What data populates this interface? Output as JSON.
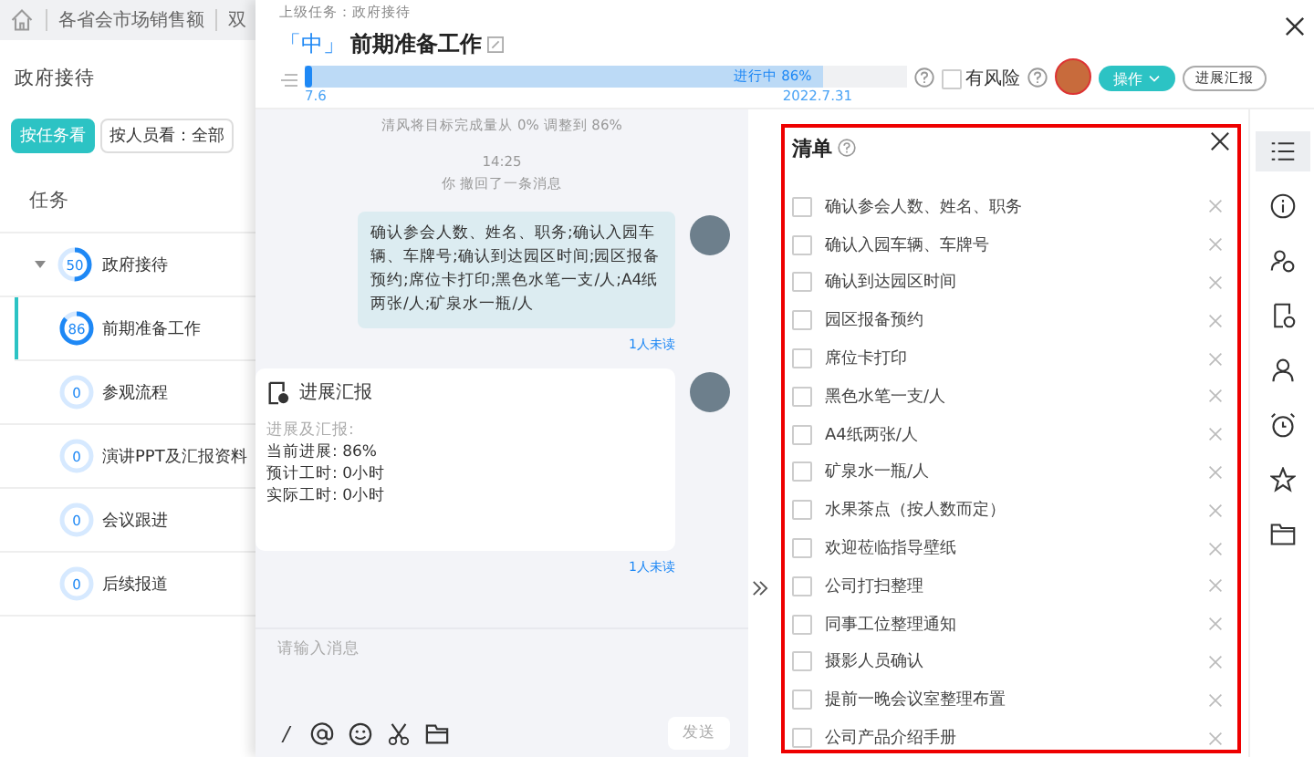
{
  "top_tabs": [
    {
      "label": "各省会市场销售额",
      "selected": false
    },
    {
      "label": "双",
      "selected": false
    }
  ],
  "left": {
    "title": "政府接待",
    "view_buttons": [
      {
        "label": "按任务看",
        "selected": true
      },
      {
        "label": "按人员看：全部",
        "selected": false
      }
    ],
    "column": "任务",
    "tree": [
      {
        "progress": "50",
        "label": "政府接待",
        "expanded": true,
        "selected": false,
        "children": [
          {
            "progress": "86",
            "label": "前期准备工作",
            "selected": true
          },
          {
            "progress": "0",
            "label": "参观流程",
            "selected": false
          },
          {
            "progress": "0",
            "label": "演讲PPT及汇报资料",
            "selected": false
          },
          {
            "progress": "0",
            "label": "会议跟进",
            "selected": false
          },
          {
            "progress": "0",
            "label": "后续报道",
            "selected": false
          }
        ]
      }
    ]
  },
  "task": {
    "parent": "上级任务：政府接待",
    "priority": "「中」",
    "title": "前期准备工作",
    "progress": {
      "label": "进行中 86%",
      "level": 0.86,
      "start": "7.6",
      "end": "2022.7.31"
    },
    "risk": {
      "label": "有风险",
      "checked": false
    },
    "actions": [
      "操作",
      "进展汇报"
    ]
  },
  "chat": [
    {
      "kind": "system",
      "text": "清风将目标完成量从 0% 调整到 86%"
    },
    {
      "kind": "system",
      "time": "14:25",
      "text": "你 撤回了一条消息"
    },
    {
      "kind": "message",
      "text": "确认参会人数、姓名、职务;确认入园车辆、车牌号;确认到达园区时间;园区报备预约;席位卡打印;黑色水笔一支/人;A4纸两张/人;矿泉水一瓶/人",
      "read": "1人未读"
    },
    {
      "kind": "report",
      "title": "进展汇报",
      "lines": [
        "进展及汇报:",
        "当前进展: 86%",
        "预计工时: 0小时",
        "实际工时: 0小时"
      ],
      "read": "1人未读"
    }
  ],
  "composer": {
    "placeholder": "请输入消息",
    "slash": "/",
    "send": "发送"
  },
  "checklist": {
    "title": "清单",
    "items": [
      {
        "label": "确认参会人数、姓名、职务",
        "checked": false
      },
      {
        "label": "确认入园车辆、车牌号",
        "checked": false
      },
      {
        "label": "确认到达园区时间",
        "checked": false
      },
      {
        "label": "园区报备预约",
        "checked": false
      },
      {
        "label": "席位卡打印",
        "checked": false
      },
      {
        "label": "黑色水笔一支/人",
        "checked": false
      },
      {
        "label": "A4纸两张/人",
        "checked": false
      },
      {
        "label": "矿泉水一瓶/人",
        "checked": false
      },
      {
        "label": "水果茶点（按人数而定）",
        "checked": false
      },
      {
        "label": "欢迎莅临指导壁纸",
        "checked": false
      },
      {
        "label": "公司打扫整理",
        "checked": false
      },
      {
        "label": "同事工位整理通知",
        "checked": false
      },
      {
        "label": "摄影人员确认",
        "checked": false
      },
      {
        "label": "提前一晚会议室整理布置",
        "checked": false
      },
      {
        "label": "公司产品介绍手册",
        "checked": false
      }
    ]
  },
  "rail": [
    {
      "kind": "list",
      "selected": true
    },
    {
      "kind": "info",
      "selected": false
    },
    {
      "kind": "user-settings",
      "selected": false
    },
    {
      "kind": "document",
      "selected": false
    },
    {
      "kind": "person",
      "selected": false
    },
    {
      "kind": "alarm",
      "selected": false
    },
    {
      "kind": "star",
      "selected": false
    },
    {
      "kind": "folder",
      "selected": false
    }
  ]
}
